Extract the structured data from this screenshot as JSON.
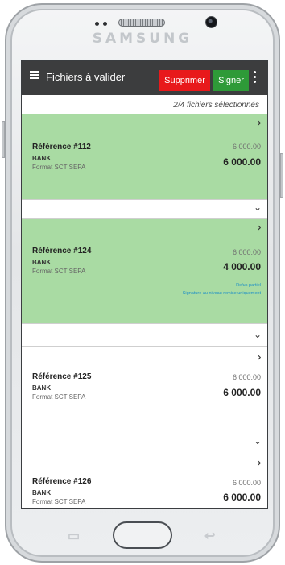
{
  "device": {
    "brand": "SAMSUNG"
  },
  "appbar": {
    "title": "Fichiers à valider",
    "delete_label": "Supprimer",
    "sign_label": "Signer",
    "delete_color": "#e8191b",
    "sign_color": "#2e9a38"
  },
  "selection": {
    "count_text": "2/4 fichiers sélectionnés"
  },
  "files": [
    {
      "reference": "Référence #112",
      "bank": "BANK",
      "format": "Format SCT SEPA",
      "amount_total": "6 000.00",
      "amount_selected": "6 000.00",
      "selected": true
    },
    {
      "reference": "Référence #124",
      "bank": "BANK",
      "format": "Format SCT SEPA",
      "amount_total": "6 000.00",
      "amount_selected": "4 000.00",
      "selected": true,
      "note_1": "Refus partiel",
      "note_2": "Signature au niveau remise uniquement"
    },
    {
      "reference": "Référence #125",
      "bank": "BANK",
      "format": "Format SCT SEPA",
      "amount_total": "6 000.00",
      "amount_selected": "6 000.00",
      "selected": false
    },
    {
      "reference": "Référence #126",
      "bank": "BANK",
      "format": "Format SCT SEPA",
      "amount_total": "6 000.00",
      "amount_selected": "6 000.00",
      "selected": false
    }
  ],
  "icons": {
    "chevron_right": "›",
    "chevron_down": "⌄"
  },
  "colors": {
    "selected_row": "#a9dba3",
    "appbar": "#3c3d3e",
    "note_text": "#1c8ec7"
  }
}
